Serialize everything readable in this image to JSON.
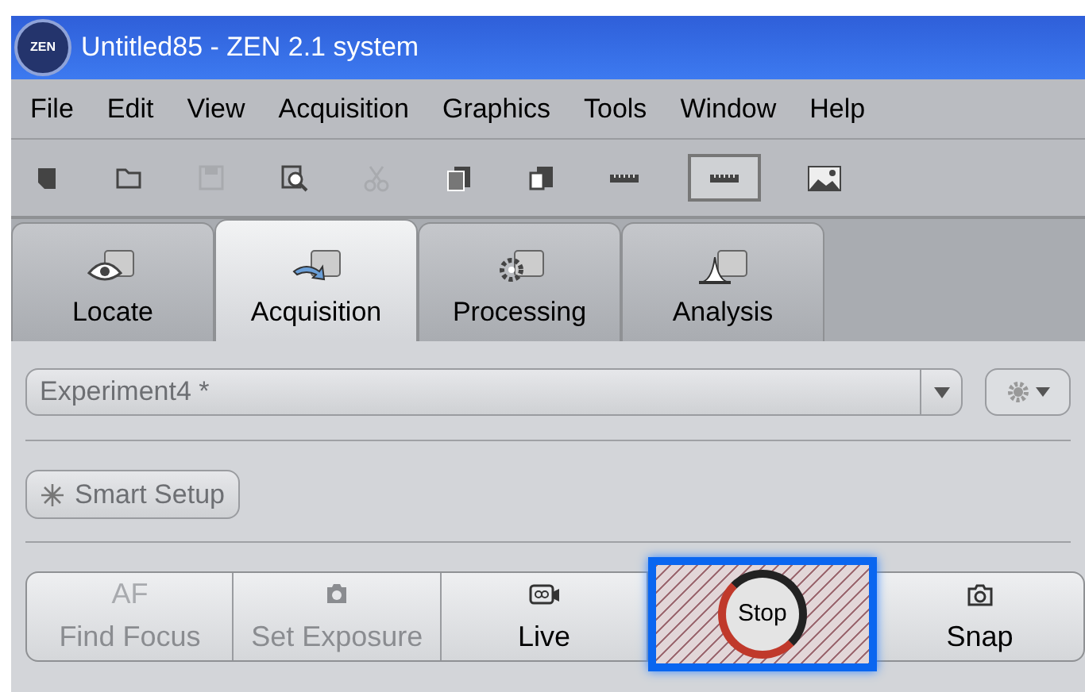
{
  "window": {
    "logo": "ZEN",
    "title": "Untitled85 - ZEN 2.1 system"
  },
  "menu": [
    "File",
    "Edit",
    "View",
    "Acquisition",
    "Graphics",
    "Tools",
    "Window",
    "Help"
  ],
  "toolbar": [
    {
      "kind": "new",
      "disabled": false,
      "pressed": false
    },
    {
      "kind": "open",
      "disabled": false,
      "pressed": false
    },
    {
      "kind": "save",
      "disabled": true,
      "pressed": false
    },
    {
      "kind": "zoom",
      "disabled": false,
      "pressed": false
    },
    {
      "kind": "cut",
      "disabled": true,
      "pressed": false
    },
    {
      "kind": "copy",
      "disabled": false,
      "pressed": false
    },
    {
      "kind": "paste",
      "disabled": false,
      "pressed": false
    },
    {
      "kind": "ruler",
      "disabled": false,
      "pressed": false
    },
    {
      "kind": "ruler",
      "disabled": false,
      "pressed": true
    },
    {
      "kind": "image",
      "disabled": false,
      "pressed": false
    }
  ],
  "tabs": [
    {
      "label": "Locate",
      "kind": "eye",
      "selected": false
    },
    {
      "label": "Acquisition",
      "kind": "arrow",
      "selected": true
    },
    {
      "label": "Processing",
      "kind": "gear",
      "selected": false
    },
    {
      "label": "Analysis",
      "kind": "peak",
      "selected": false
    }
  ],
  "experiment": {
    "value": "Experiment4 *"
  },
  "smart_setup": {
    "label": "Smart Setup"
  },
  "actions": [
    {
      "label": "Find Focus",
      "kind": "af",
      "icon_text": "AF",
      "disabled": true
    },
    {
      "label": "Set Exposure",
      "kind": "camera",
      "disabled": true
    },
    {
      "label": "Live",
      "kind": "video",
      "disabled": false
    },
    {
      "label": "Stop",
      "kind": "stop",
      "disabled": false
    },
    {
      "label": "Snap",
      "kind": "snap",
      "disabled": false
    }
  ]
}
